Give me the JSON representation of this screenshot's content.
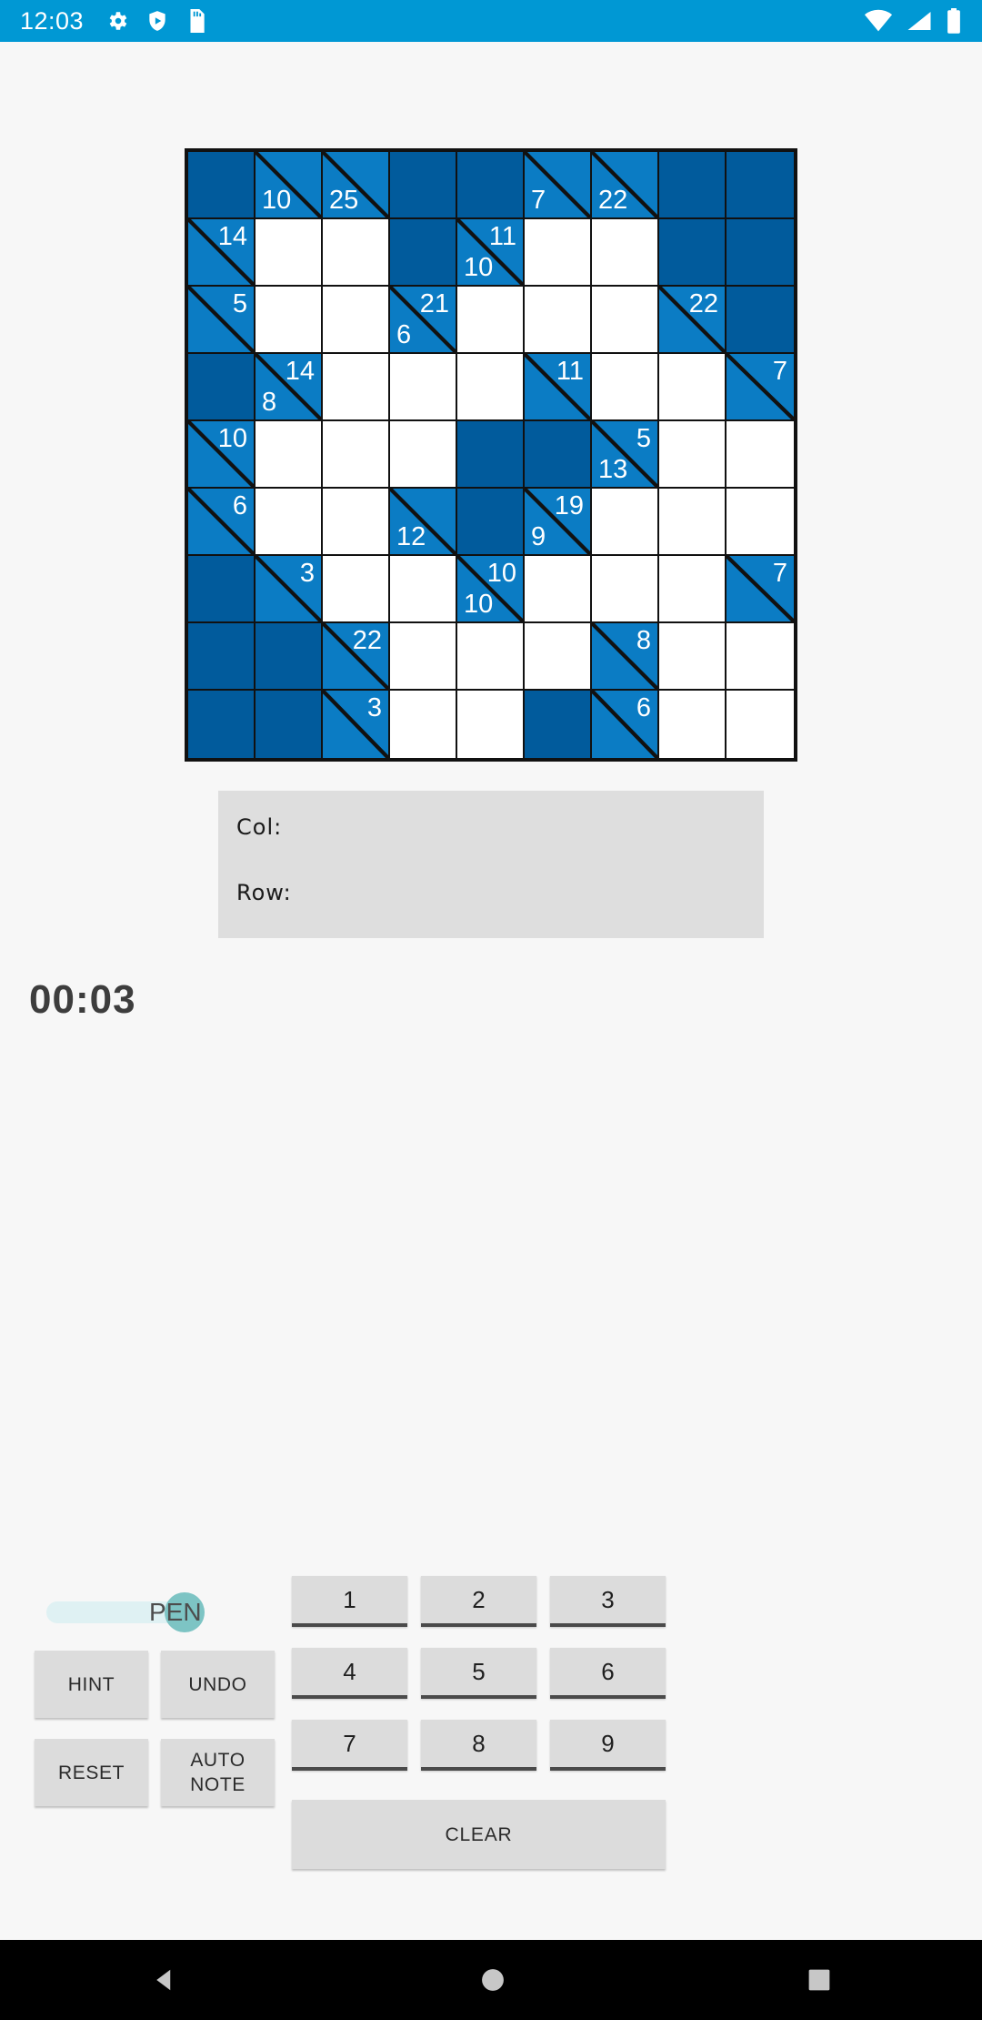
{
  "status_bar": {
    "time": "12:03",
    "left_icons": [
      "gear-icon",
      "play-shield-icon",
      "sd-card-icon"
    ],
    "right_icons": [
      "wifi-icon",
      "signal-icon",
      "battery-icon"
    ],
    "background": "#0098d4"
  },
  "board": {
    "rows": 9,
    "cols": 9,
    "colors": {
      "block": "#015b9c",
      "clue": "#0b7cc4",
      "open": "#ffffff",
      "border": "#111111"
    },
    "cells": [
      [
        {
          "t": "block"
        },
        {
          "t": "clue",
          "down": "10"
        },
        {
          "t": "clue",
          "down": "25"
        },
        {
          "t": "block"
        },
        {
          "t": "block"
        },
        {
          "t": "clue",
          "down": "7"
        },
        {
          "t": "clue",
          "down": "22"
        },
        {
          "t": "block"
        },
        {
          "t": "block"
        }
      ],
      [
        {
          "t": "clue",
          "across": "14"
        },
        {
          "t": "open",
          "v": ""
        },
        {
          "t": "open",
          "v": ""
        },
        {
          "t": "block"
        },
        {
          "t": "clue",
          "across": "11",
          "down": "10"
        },
        {
          "t": "open",
          "v": ""
        },
        {
          "t": "open",
          "v": ""
        },
        {
          "t": "block"
        },
        {
          "t": "block"
        }
      ],
      [
        {
          "t": "clue",
          "across": "5"
        },
        {
          "t": "open",
          "v": ""
        },
        {
          "t": "open",
          "v": ""
        },
        {
          "t": "clue",
          "across": "21",
          "down": "6"
        },
        {
          "t": "open",
          "v": ""
        },
        {
          "t": "open",
          "v": ""
        },
        {
          "t": "open",
          "v": ""
        },
        {
          "t": "clue",
          "across": "22"
        },
        {
          "t": "block"
        }
      ],
      [
        {
          "t": "block"
        },
        {
          "t": "clue",
          "across": "14",
          "down": "8"
        },
        {
          "t": "open",
          "v": ""
        },
        {
          "t": "open",
          "v": ""
        },
        {
          "t": "open",
          "v": ""
        },
        {
          "t": "clue",
          "across": "11"
        },
        {
          "t": "open",
          "v": ""
        },
        {
          "t": "open",
          "v": ""
        },
        {
          "t": "clue",
          "across": "7"
        }
      ],
      [
        {
          "t": "clue",
          "across": "10"
        },
        {
          "t": "open",
          "v": ""
        },
        {
          "t": "open",
          "v": ""
        },
        {
          "t": "open",
          "v": ""
        },
        {
          "t": "block"
        },
        {
          "t": "block"
        },
        {
          "t": "clue",
          "across": "5",
          "down": "13"
        },
        {
          "t": "open",
          "v": ""
        },
        {
          "t": "open",
          "v": ""
        }
      ],
      [
        {
          "t": "clue",
          "across": "6"
        },
        {
          "t": "open",
          "v": ""
        },
        {
          "t": "open",
          "v": ""
        },
        {
          "t": "clue",
          "down": "12"
        },
        {
          "t": "block"
        },
        {
          "t": "clue",
          "across": "19",
          "down": "9"
        },
        {
          "t": "open",
          "v": ""
        },
        {
          "t": "open",
          "v": ""
        },
        {
          "t": "open",
          "v": ""
        }
      ],
      [
        {
          "t": "block"
        },
        {
          "t": "clue",
          "across": "3"
        },
        {
          "t": "open",
          "v": ""
        },
        {
          "t": "open",
          "v": ""
        },
        {
          "t": "clue",
          "across": "10",
          "down": "10"
        },
        {
          "t": "open",
          "v": ""
        },
        {
          "t": "open",
          "v": ""
        },
        {
          "t": "open",
          "v": ""
        },
        {
          "t": "clue",
          "across": "7"
        }
      ],
      [
        {
          "t": "block"
        },
        {
          "t": "block"
        },
        {
          "t": "clue",
          "across": "22"
        },
        {
          "t": "open",
          "v": ""
        },
        {
          "t": "open",
          "v": ""
        },
        {
          "t": "open",
          "v": ""
        },
        {
          "t": "clue",
          "across": "8"
        },
        {
          "t": "open",
          "v": ""
        },
        {
          "t": "open",
          "v": ""
        }
      ],
      [
        {
          "t": "block"
        },
        {
          "t": "block"
        },
        {
          "t": "clue",
          "across": "3"
        },
        {
          "t": "open",
          "v": ""
        },
        {
          "t": "open",
          "v": ""
        },
        {
          "t": "block"
        },
        {
          "t": "clue",
          "across": "6"
        },
        {
          "t": "open",
          "v": ""
        },
        {
          "t": "open",
          "v": ""
        }
      ]
    ]
  },
  "info_panel": {
    "col_label": "Col:",
    "col_value": "",
    "row_label": "Row:",
    "row_value": ""
  },
  "timer": {
    "value": "00:03"
  },
  "pen_toggle": {
    "label": "PEN",
    "checked": true
  },
  "action_buttons": {
    "hint": "HINT",
    "undo": "UNDO",
    "reset": "RESET",
    "auto_note": "AUTO NOTE",
    "clear": "CLEAR"
  },
  "numpad": {
    "row1": [
      "1",
      "2",
      "3"
    ],
    "row2": [
      "4",
      "5",
      "6"
    ],
    "row3": [
      "7",
      "8",
      "9"
    ]
  },
  "nav_bar": {
    "back": "back-triangle-icon",
    "home": "home-circle-icon",
    "recents": "recents-square-icon"
  }
}
